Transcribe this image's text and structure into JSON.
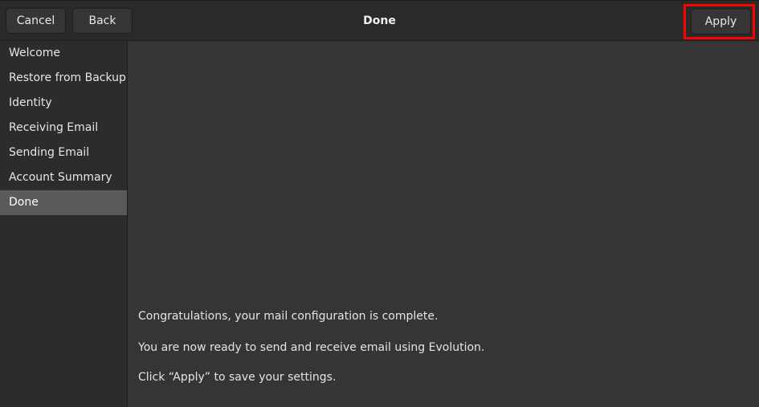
{
  "header": {
    "title": "Done",
    "cancel_label": "Cancel",
    "back_label": "Back",
    "apply_label": "Apply",
    "highlight_color": "#ff0000"
  },
  "sidebar": {
    "items": [
      {
        "label": "Welcome",
        "selected": false
      },
      {
        "label": "Restore from Backup",
        "selected": false
      },
      {
        "label": "Identity",
        "selected": false
      },
      {
        "label": "Receiving Email",
        "selected": false
      },
      {
        "label": "Sending Email",
        "selected": false
      },
      {
        "label": "Account Summary",
        "selected": false
      },
      {
        "label": "Done",
        "selected": true
      }
    ]
  },
  "content": {
    "line1": "Congratulations, your mail configuration is complete.",
    "line2": "You are now ready to send and receive email using Evolution.",
    "line3": "Click “Apply” to save your settings."
  },
  "colors": {
    "window_bg": "#353535",
    "header_bg": "#2a2a2a",
    "sidebar_bg": "#2c2c2c",
    "selected_bg": "#5a5a5a"
  }
}
